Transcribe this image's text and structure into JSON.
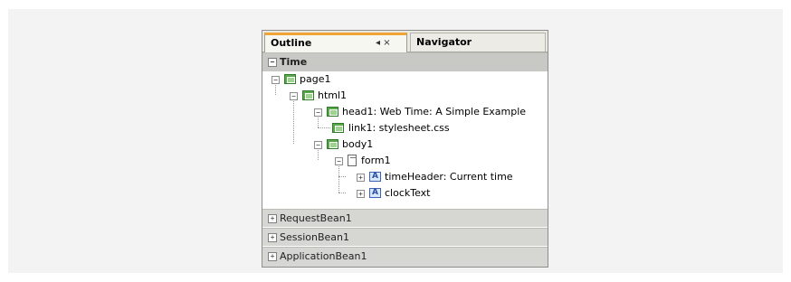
{
  "tabs": {
    "outline": "Outline",
    "outline_controls": "◂ ×",
    "navigator": "Navigator"
  },
  "sections": {
    "time": "Time",
    "request": "RequestBean1",
    "session": "SessionBean1",
    "application": "ApplicationBean1"
  },
  "tree": {
    "page": "page1",
    "html": "html1",
    "head": "head1: Web Time: A Simple Example",
    "link": "link1: stylesheet.css",
    "body": "body1",
    "form": "form1",
    "header": "timeHeader: Current time",
    "clock": "clockText"
  },
  "icons": {
    "expanded": "−",
    "collapsed": "+",
    "text_icon": "A"
  }
}
